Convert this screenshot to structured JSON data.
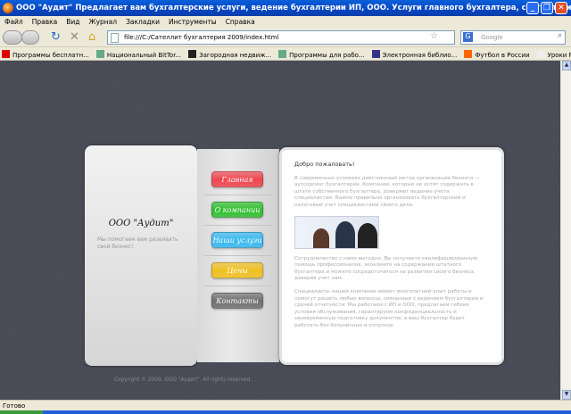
{
  "window": {
    "title": "ООО \"Аудит\" Предлагает вам бухгалтерские услуги, ведение бухгалтерии ИП, ООО. Услуги главного бухгалтера, составление отчетности - ..."
  },
  "menu": [
    "Файл",
    "Правка",
    "Вид",
    "Журнал",
    "Закладки",
    "Инструменты",
    "Справка"
  ],
  "toolbar": {
    "url": "file:///C:/Сателлит бухгалтерия 2009/index.html",
    "search_placeholder": "Google"
  },
  "bookmarks": [
    {
      "label": "Программы бесплатн...",
      "icon": "star-icon",
      "color": "#d00"
    },
    {
      "label": "Национальный BitTor...",
      "icon": "torrent-icon",
      "color": "#6a8"
    },
    {
      "label": "Загородная недвиж...",
      "icon": "li-icon",
      "color": "#222"
    },
    {
      "label": "Программы для рабо...",
      "icon": "torrent-icon",
      "color": "#6a8"
    },
    {
      "label": "Электронная библио...",
      "icon": "library-icon",
      "color": "#338"
    },
    {
      "label": "Футбол в России",
      "icon": "blogger-icon",
      "color": "#f60"
    },
    {
      "label": "Уроки Photoshop | С...",
      "icon": "page-icon",
      "color": "#eee"
    }
  ],
  "site": {
    "company": "ООО \"Аудит\"",
    "slogan": "Мы помогаем вам развивать свой бизнес!",
    "nav": [
      {
        "label": "Главная",
        "color": "#f04650"
      },
      {
        "label": "О компании",
        "color": "#2fbf2f"
      },
      {
        "label": "Наши услуги",
        "color": "#36b8f0"
      },
      {
        "label": "Цены",
        "color": "#f0c020"
      },
      {
        "label": "Контакты",
        "color": "#707070"
      }
    ],
    "welcome": "Добро пожаловать!",
    "paragraphs": [
      "В современных условиях действенный метод организации бизнеса — аутсорсинг бухгалтерии. Компании, которые не хотят содержать в штате собственного бухгалтера, доверяют ведение учета специалистам. Важно правильно организовать бухгалтерский и налоговый учет специалистами своего дела.",
      "Сотрудничество с нами выгодно. Вы получаете квалифицированную помощь профессионалов, экономите на содержании штатного бухгалтера и можете сосредоточиться на развитии своего бизнеса, доверив учет нам.",
      "Специалисты нашей компании имеют многолетний опыт работы и помогут решить любые вопросы, связанные с ведением бухгалтерии и сдачей отчетности. Мы работаем с ИП и ООО, предлагаем гибкие условия обслуживания, гарантируем конфиденциальность и своевременную подготовку документов, а ваш бухгалтер будет работать без больничных и отпусков."
    ],
    "copyright": "Copyright © 2009, ООО \"Аудит\". All rights reserved."
  },
  "status": "Готово"
}
